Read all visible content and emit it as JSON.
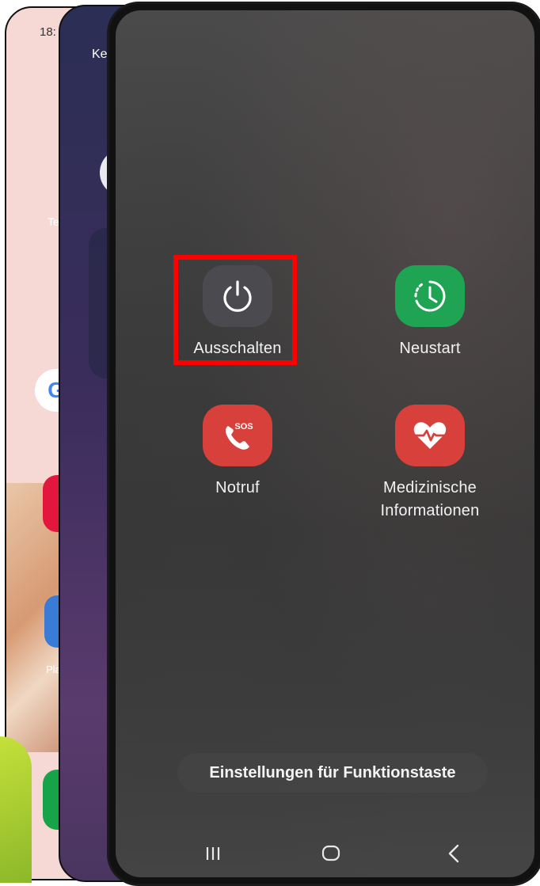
{
  "background_phones": {
    "phone1": {
      "time_partial": "18:",
      "label_partial": "Te",
      "google_letter": "G",
      "app_label_partial": "Pla"
    },
    "phone2": {
      "label_partial": "Ke"
    }
  },
  "power_menu": {
    "actions": [
      {
        "id": "power-off",
        "label": "Ausschalten",
        "icon": "power-icon",
        "color": "#4b4b4f",
        "highlighted": true
      },
      {
        "id": "restart",
        "label": "Neustart",
        "icon": "restart-icon",
        "color": "#1ea453",
        "highlighted": false
      },
      {
        "id": "emergency-call",
        "label": "Notruf",
        "icon": "sos-phone-icon",
        "icon_text": "SOS",
        "color": "#d8403b",
        "highlighted": false
      },
      {
        "id": "medical-info",
        "label_line1": "Medizinische",
        "label_line2": "Informationen",
        "icon": "heart-pulse-icon",
        "color": "#d8403b",
        "highlighted": false
      }
    ],
    "settings_button": "Einstellungen für Funktionstaste",
    "highlight_color": "#ff0000"
  },
  "navigation_bar": {
    "buttons": [
      "recents",
      "home",
      "back"
    ]
  }
}
